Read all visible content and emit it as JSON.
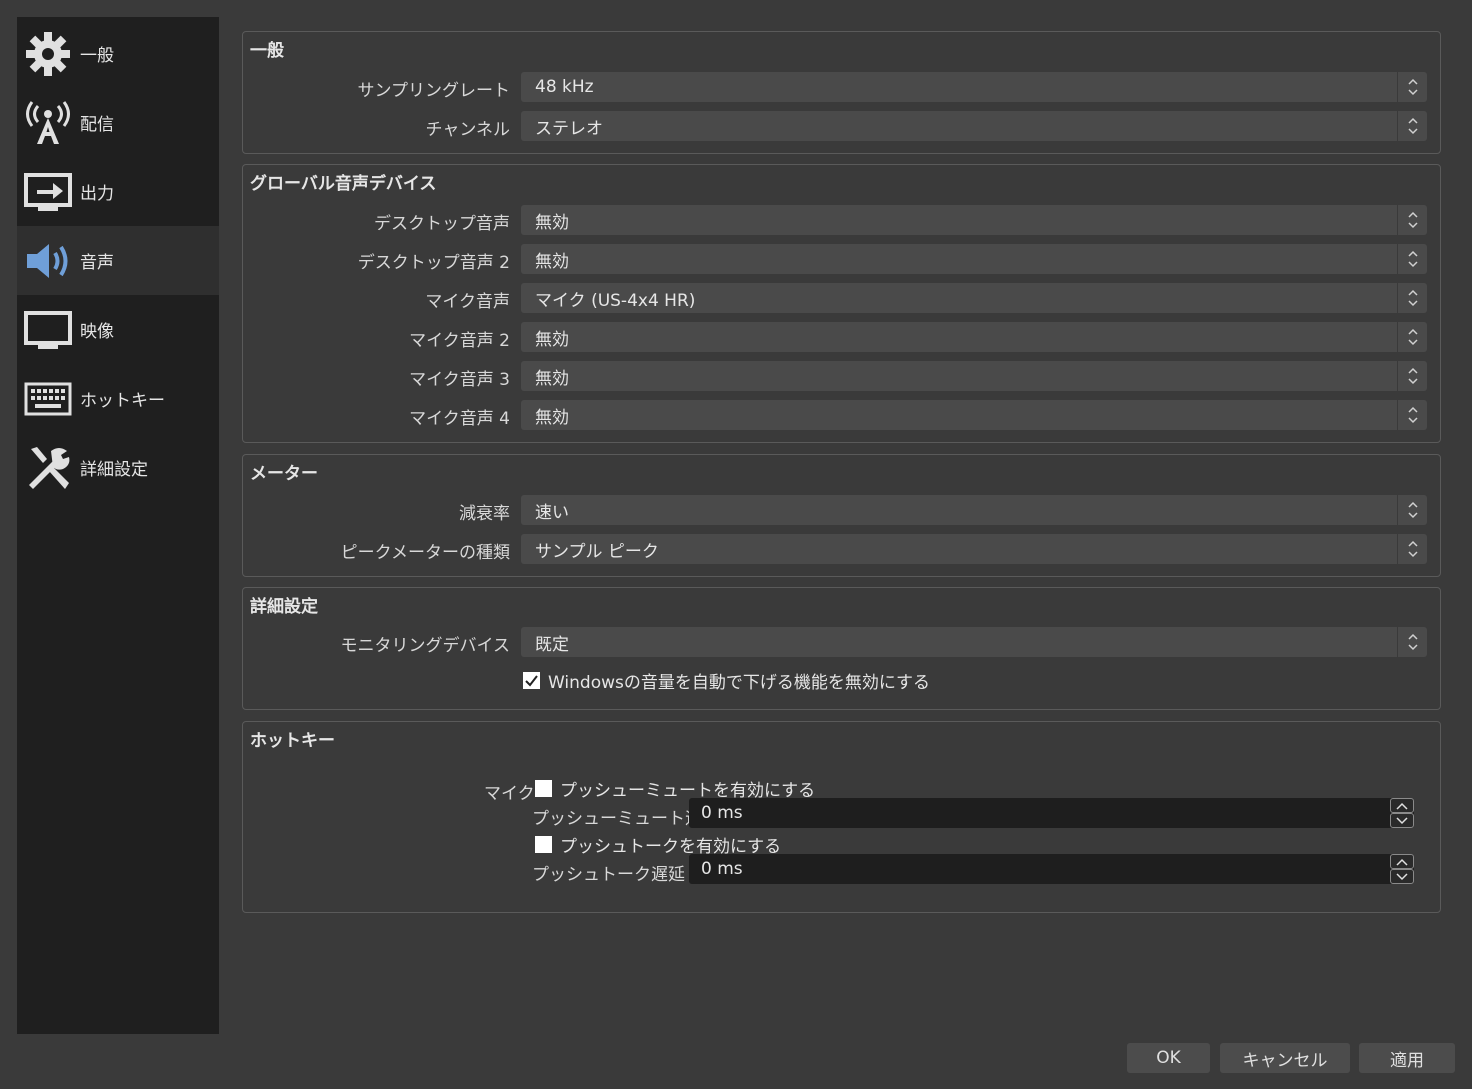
{
  "sidebar": {
    "items": [
      {
        "label": "一般",
        "icon": "gear-icon"
      },
      {
        "label": "配信",
        "icon": "broadcast-icon"
      },
      {
        "label": "出力",
        "icon": "output-icon"
      },
      {
        "label": "音声",
        "icon": "speaker-icon"
      },
      {
        "label": "映像",
        "icon": "monitor-icon"
      },
      {
        "label": "ホットキー",
        "icon": "keyboard-icon"
      },
      {
        "label": "詳細設定",
        "icon": "tools-icon"
      }
    ],
    "active": "音声"
  },
  "general": {
    "title": "一般",
    "sample_rate_label": "サンプリングレート",
    "sample_rate_value": "48 kHz",
    "channel_label": "チャンネル",
    "channel_value": "ステレオ"
  },
  "global_devices": {
    "title": "グローバル音声デバイス",
    "rows": [
      {
        "label": "デスクトップ音声",
        "value": "無効"
      },
      {
        "label": "デスクトップ音声 2",
        "value": "無効"
      },
      {
        "label": "マイク音声",
        "value": "マイク (US-4x4 HR)"
      },
      {
        "label": "マイク音声 2",
        "value": "無効"
      },
      {
        "label": "マイク音声 3",
        "value": "無効"
      },
      {
        "label": "マイク音声 4",
        "value": "無効"
      }
    ]
  },
  "meters": {
    "title": "メーター",
    "decay_label": "減衰率",
    "decay_value": "速い",
    "peak_label": "ピークメーターの種類",
    "peak_value": "サンプル ピーク"
  },
  "advanced": {
    "title": "詳細設定",
    "monitoring_label": "モニタリングデバイス",
    "monitoring_value": "既定",
    "ducking_label": "Windowsの音量を自動で下げる機能を無効にする",
    "ducking_checked": true
  },
  "hotkeys": {
    "title": "ホットキー",
    "source_label": "マイク",
    "push_mute_label": "プッシューミュートを有効にする",
    "push_mute_checked": false,
    "push_mute_delay_label": "プッシューミュート遅延",
    "push_mute_delay_value": "0 ms",
    "push_talk_label": "プッシュトークを有効にする",
    "push_talk_checked": false,
    "push_talk_delay_label": "プッシュトーク遅延",
    "push_talk_delay_value": "0 ms"
  },
  "footer": {
    "ok": "OK",
    "cancel": "キャンセル",
    "apply": "適用"
  }
}
